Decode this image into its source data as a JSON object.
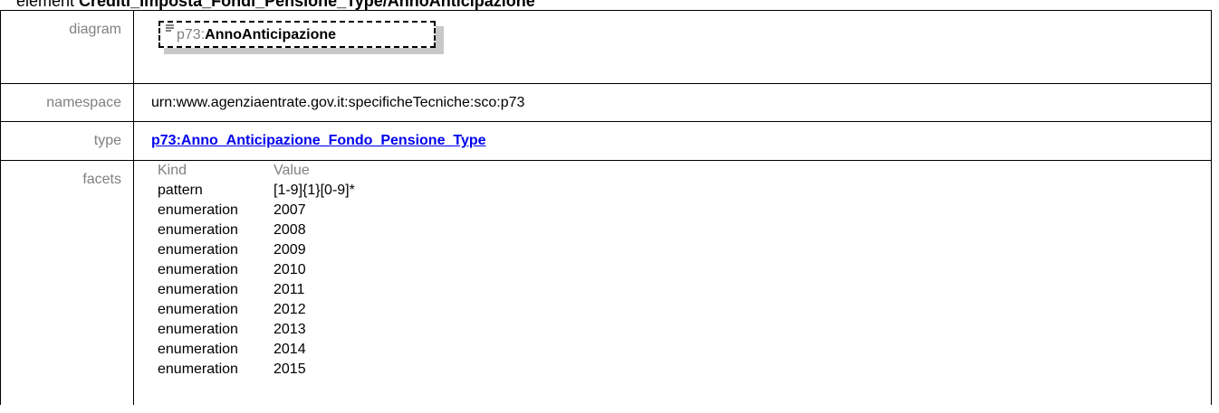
{
  "heading": {
    "prefix": "element ",
    "identifier": "Crediti_Imposta_Fondi_Pensione_Type/AnnoAnticipazione"
  },
  "diagram": {
    "label": "diagram",
    "node_namespace": "p73:",
    "node_name": "AnnoAnticipazione"
  },
  "namespace": {
    "label": "namespace",
    "value": "urn:www.agenziaentrate.gov.it:specificheTecniche:sco:p73"
  },
  "type": {
    "label": "type",
    "value": "p73:Anno_Anticipazione_Fondo_Pensione_Type"
  },
  "facets": {
    "label": "facets",
    "headers": {
      "kind": "Kind",
      "value": "Value"
    },
    "rows": [
      {
        "kind": "pattern",
        "value": "[1-9]{1}[0-9]*"
      },
      {
        "kind": "enumeration",
        "value": "2007"
      },
      {
        "kind": "enumeration",
        "value": "2008"
      },
      {
        "kind": "enumeration",
        "value": "2009"
      },
      {
        "kind": "enumeration",
        "value": "2010"
      },
      {
        "kind": "enumeration",
        "value": "2011"
      },
      {
        "kind": "enumeration",
        "value": "2012"
      },
      {
        "kind": "enumeration",
        "value": "2013"
      },
      {
        "kind": "enumeration",
        "value": "2014"
      },
      {
        "kind": "enumeration",
        "value": "2015"
      }
    ]
  }
}
